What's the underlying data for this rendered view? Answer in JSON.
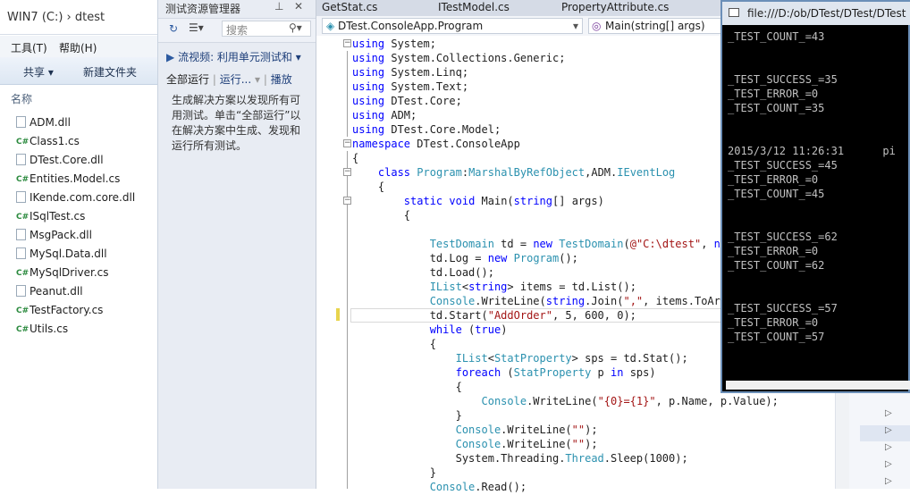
{
  "explorer": {
    "breadcrumb": "WIN7 (C:)  ›  dtest",
    "menu": [
      "工具(T)",
      "帮助(H)"
    ],
    "commands": [
      "共享 ▾",
      "新建文件夹"
    ],
    "column_header": "名称",
    "files": [
      {
        "name": "ADM.dll",
        "type": "dll"
      },
      {
        "name": "Class1.cs",
        "type": "cs"
      },
      {
        "name": "DTest.Core.dll",
        "type": "dll"
      },
      {
        "name": "Entities.Model.cs",
        "type": "cs"
      },
      {
        "name": "IKende.com.core.dll",
        "type": "dll"
      },
      {
        "name": "ISqlTest.cs",
        "type": "cs"
      },
      {
        "name": "MsgPack.dll",
        "type": "dll"
      },
      {
        "name": "MySql.Data.dll",
        "type": "dll"
      },
      {
        "name": "MySqlDriver.cs",
        "type": "cs"
      },
      {
        "name": "Peanut.dll",
        "type": "dll"
      },
      {
        "name": "TestFactory.cs",
        "type": "cs"
      },
      {
        "name": "Utils.cs",
        "type": "cs"
      }
    ]
  },
  "test_explorer": {
    "title": "测试资源管理器",
    "search_placeholder": "搜索",
    "banner": "流视频: 利用单元测试和",
    "run_all": "全部运行",
    "run": "运行...",
    "playlist": "播放",
    "description": "生成解决方案以发现所有可用测试。单击“全部运行”以在解决方案中生成、发现和运行所有测试。"
  },
  "editor": {
    "tabs": [
      "GetStat.cs",
      "ITestModel.cs",
      "PropertyAttribute.cs"
    ],
    "nav_left": "DTest.ConsoleApp.Program",
    "nav_right": "Main(string[] args)"
  },
  "console": {
    "title": "file:///D:/ob/DTest/DTest/DTest",
    "lines": [
      "_TEST_COUNT_=43",
      "",
      "",
      "_TEST_SUCCESS_=35",
      "_TEST_ERROR_=0",
      "_TEST_COUNT_=35",
      "",
      "",
      "2015/3/12 11:26:31      pi",
      "_TEST_SUCCESS_=45",
      "_TEST_ERROR_=0",
      "_TEST_COUNT_=45",
      "",
      "",
      "_TEST_SUCCESS_=62",
      "_TEST_ERROR_=0",
      "_TEST_COUNT_=62",
      "",
      "",
      "_TEST_SUCCESS_=57",
      "_TEST_ERROR_=0",
      "_TEST_COUNT_=57"
    ]
  },
  "colors": {
    "keyword": "#0000ff",
    "type": "#2b91af",
    "string": "#a31515",
    "console_bg": "#000000"
  }
}
